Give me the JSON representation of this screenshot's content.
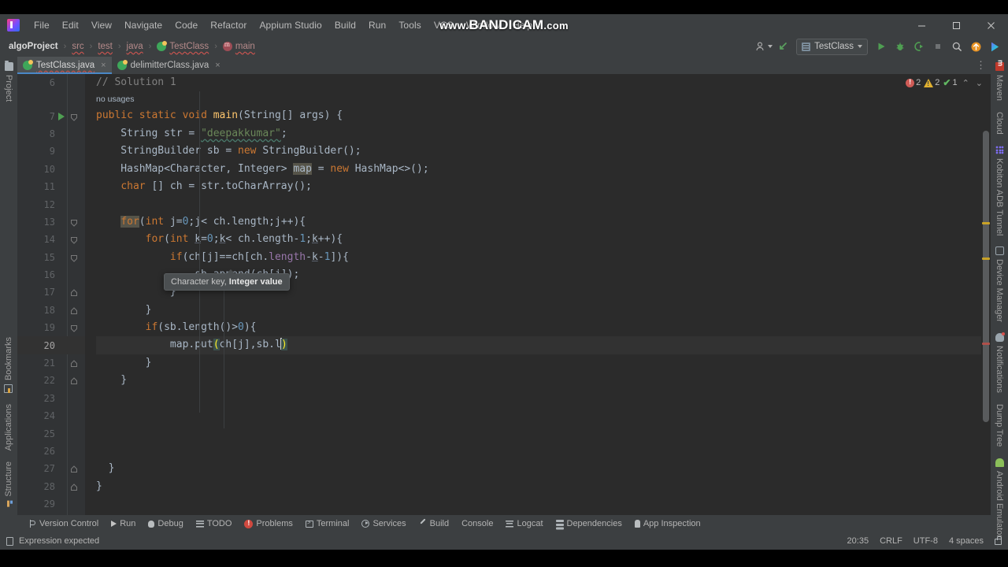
{
  "window": {
    "watermark": "www.BANDICAM.com",
    "watermark_www": "www.",
    "watermark_brand": "BANDICAM",
    "watermark_tld": ".com",
    "minimize": "−",
    "maximize": "❐",
    "close": "✕"
  },
  "menu": {
    "items": [
      "File",
      "Edit",
      "View",
      "Navigate",
      "Code",
      "Refactor",
      "Appium Studio",
      "Build",
      "Run",
      "Tools",
      "VCS",
      "Window",
      "Help"
    ]
  },
  "breadcrumbs": {
    "items": [
      {
        "label": "algoProject",
        "icon": "none",
        "error": false,
        "root": true
      },
      {
        "label": "src",
        "icon": "none",
        "error": true,
        "root": false
      },
      {
        "label": "test",
        "icon": "none",
        "error": true,
        "root": false
      },
      {
        "label": "java",
        "icon": "none",
        "error": true,
        "root": false
      },
      {
        "label": "TestClass",
        "icon": "class-icon",
        "error": true,
        "root": false
      },
      {
        "label": "main",
        "icon": "method-icon",
        "error": true,
        "root": false
      }
    ],
    "separator": "›"
  },
  "toolbar": {
    "account_label": "",
    "vcs_update_label": "",
    "run_config": "TestClass",
    "run_label": "Run",
    "debug_label": "Debug",
    "coverage_label": "Run with Coverage",
    "stop_label": "Stop",
    "search_label": "Search Everywhere",
    "updates_label": "Updates",
    "assistant_label": "AI Assistant"
  },
  "left_strip": {
    "top": [
      {
        "label": "Project",
        "icon": "folder-icon"
      }
    ],
    "bottom": [
      {
        "label": "Bookmarks",
        "icon": "bookmark-icon"
      },
      {
        "label": "Applications",
        "icon": "none"
      },
      {
        "label": "Structure",
        "icon": "structure-icon"
      }
    ]
  },
  "right_strip": {
    "items": [
      {
        "label": "Maven",
        "icon": "maven-icon"
      },
      {
        "label": "Cloud",
        "icon": "none"
      },
      {
        "label": "Kobiton ADB Tunnel",
        "icon": "grid-icon"
      },
      {
        "label": "Device Manager",
        "icon": "device-icon"
      },
      {
        "label": "Notifications",
        "icon": "bell-icon"
      },
      {
        "label": "Dump Tree",
        "icon": "none"
      },
      {
        "label": "Android Emulator",
        "icon": "android-icon"
      }
    ]
  },
  "editor_tabs": {
    "tabs": [
      {
        "label": "TestClass.java",
        "active": true,
        "error": true,
        "close": "×"
      },
      {
        "label": "delimitterClass.java",
        "active": false,
        "error": false,
        "close": "×"
      }
    ],
    "options": "⋮"
  },
  "inspection_widget": {
    "errors": "2",
    "warnings": "2",
    "passed": "1",
    "prev": "⌃",
    "next": "⌄"
  },
  "editor": {
    "first_line": 6,
    "current_line": 20,
    "hint_text": "no usages",
    "lines": [
      {
        "n": 6,
        "indent": 1,
        "fold": "none",
        "run": false,
        "html": "<span class='cmt'>// Solution 1</span>"
      },
      {
        "n": 7,
        "indent": 1,
        "fold": "open",
        "run": true,
        "html": "<span class='kw'>public</span> <span class='kw'>static</span> <span class='kw'>void</span> <span class='fnm'>main</span>(String[] args) {"
      },
      {
        "n": 8,
        "indent": 2,
        "fold": "none",
        "run": false,
        "html": "    String str = <span class='str'>\"deepakkumar\"</span>;"
      },
      {
        "n": 9,
        "indent": 2,
        "fold": "none",
        "run": false,
        "html": "    StringBuilder sb = <span class='kw'>new</span> StringBuilder();"
      },
      {
        "n": 10,
        "indent": 2,
        "fold": "none",
        "run": false,
        "html": "    HashMap&lt;Character, Integer&gt; <span class='hl'>map</span> = <span class='kw'>new</span> HashMap&lt;&gt;();"
      },
      {
        "n": 11,
        "indent": 2,
        "fold": "none",
        "run": false,
        "html": "    <span class='kw'>char</span> [] ch = str.toCharArray();"
      },
      {
        "n": 12,
        "indent": 2,
        "fold": "none",
        "run": false,
        "html": ""
      },
      {
        "n": 13,
        "indent": 2,
        "fold": "open",
        "run": false,
        "html": "    <span class='hl-kw'>for</span>(<span class='kw'>int</span> j=<span class='num'>0</span>;j&lt; ch.length;j++){"
      },
      {
        "n": 14,
        "indent": 3,
        "fold": "open",
        "run": false,
        "html": "        <span class='kw'>for</span>(<span class='kw'>int</span> <span class='ident-u'>k</span>=<span class='num'>0</span>;<span class='ident-u'>k</span>&lt; ch.length-<span class='num'>1</span>;<span class='ident-u'>k</span>++){"
      },
      {
        "n": 15,
        "indent": 4,
        "fold": "open",
        "run": false,
        "html": "            <span class='kw'>if</span>(ch[j]==ch[ch.<span class='fld'>length</span>-<span class='ident-u'>k</span>-<span class='num'>1</span>]){"
      },
      {
        "n": 16,
        "indent": 5,
        "fold": "none",
        "run": false,
        "html": "                sb.append(ch[j]);"
      },
      {
        "n": 17,
        "indent": 4,
        "fold": "close",
        "run": false,
        "html": "            }"
      },
      {
        "n": 18,
        "indent": 3,
        "fold": "close",
        "run": false,
        "html": "        }"
      },
      {
        "n": 19,
        "indent": 3,
        "fold": "open",
        "run": false,
        "html": "        <span class='kw'>if</span>(sb.length()&gt;<span class='num'>0</span>){"
      },
      {
        "n": 20,
        "indent": 4,
        "fold": "none",
        "run": false,
        "html": "            map.put<span class='brmatch'>(</span>ch[j],sb.l<span class='caretbar'></span><span class='brmatch'>)</span>"
      },
      {
        "n": 21,
        "indent": 3,
        "fold": "close",
        "run": false,
        "html": "        }"
      },
      {
        "n": 22,
        "indent": 2,
        "fold": "close",
        "run": false,
        "html": "    }"
      },
      {
        "n": 23,
        "indent": 0,
        "fold": "none",
        "run": false,
        "html": ""
      },
      {
        "n": 24,
        "indent": 0,
        "fold": "none",
        "run": false,
        "html": ""
      },
      {
        "n": 25,
        "indent": 0,
        "fold": "none",
        "run": false,
        "html": ""
      },
      {
        "n": 26,
        "indent": 0,
        "fold": "none",
        "run": false,
        "html": ""
      },
      {
        "n": 27,
        "indent": 1,
        "fold": "close",
        "run": false,
        "html": "  }"
      },
      {
        "n": 28,
        "indent": 0,
        "fold": "close",
        "run": false,
        "html": "}"
      },
      {
        "n": 29,
        "indent": 0,
        "fold": "none",
        "run": false,
        "html": ""
      }
    ]
  },
  "tooltip": {
    "prefix": "Character key,",
    "strong": "Integer value"
  },
  "bottom_tools": {
    "items": [
      {
        "label": "Version Control",
        "icon": "vcs-icon"
      },
      {
        "label": "Run",
        "icon": "play-icon"
      },
      {
        "label": "Debug",
        "icon": "bug-icon"
      },
      {
        "label": "TODO",
        "icon": "todo-icon"
      },
      {
        "label": "Problems",
        "icon": "problems-icon"
      },
      {
        "label": "Terminal",
        "icon": "terminal-icon"
      },
      {
        "label": "Services",
        "icon": "services-icon"
      },
      {
        "label": "Build",
        "icon": "build-icon"
      },
      {
        "label": "Console",
        "icon": "none"
      },
      {
        "label": "Logcat",
        "icon": "logcat-icon"
      },
      {
        "label": "Dependencies",
        "icon": "dependencies-icon"
      },
      {
        "label": "App Inspection",
        "icon": "app-inspection-icon"
      }
    ]
  },
  "status_bar": {
    "message": "Expression expected",
    "caret_position": "20:35",
    "line_separator": "CRLF",
    "encoding": "UTF-8",
    "indent": "4 spaces",
    "lock": "read-write"
  },
  "colors": {
    "chrome": "#3c3f41",
    "editor_bg": "#2b2b2b",
    "gutter_bg": "#313335",
    "accent_tab": "#4a88c7",
    "keyword": "#cc7832",
    "string": "#6a8759",
    "number": "#6897bb",
    "comment": "#808080",
    "method": "#ffc66d",
    "field": "#9876aa",
    "error": "#cf5b56",
    "warning": "#e0b030",
    "ok": "#62b862"
  }
}
